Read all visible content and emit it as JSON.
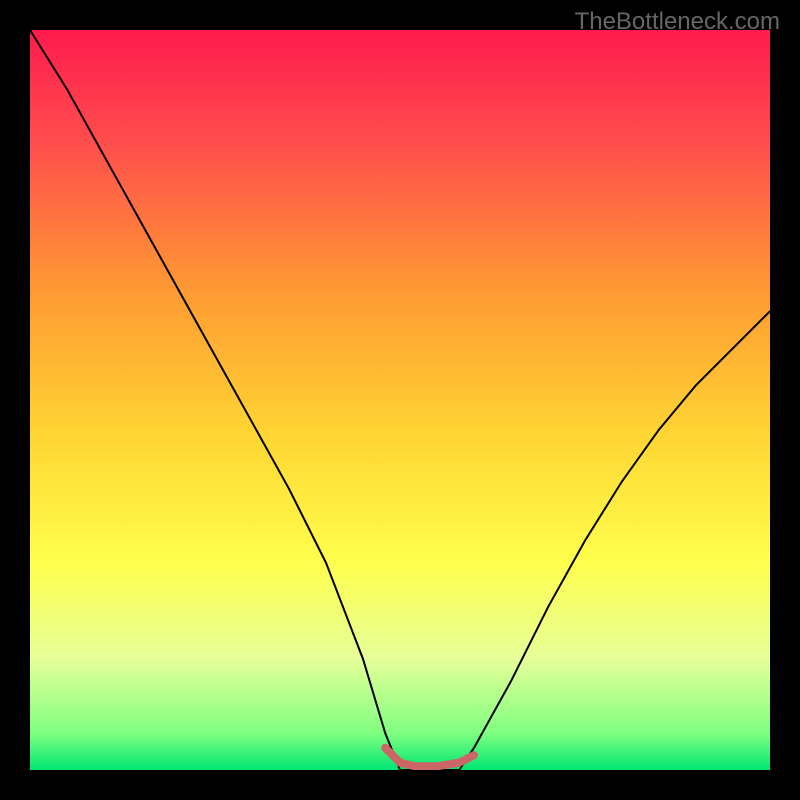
{
  "watermark": "TheBottleneck.com",
  "chart_data": {
    "type": "line",
    "title": "",
    "xlabel": "",
    "ylabel": "",
    "xlim": [
      0,
      100
    ],
    "ylim": [
      0,
      100
    ],
    "background_gradient": {
      "type": "vertical",
      "stops": [
        {
          "pos": 0.0,
          "color": "#ff1a4d"
        },
        {
          "pos": 0.15,
          "color": "#ff4d4d"
        },
        {
          "pos": 0.35,
          "color": "#ff9933"
        },
        {
          "pos": 0.55,
          "color": "#ffd633"
        },
        {
          "pos": 0.72,
          "color": "#ffff4d"
        },
        {
          "pos": 0.85,
          "color": "#e6ff99"
        },
        {
          "pos": 0.95,
          "color": "#80ff80"
        },
        {
          "pos": 1.0,
          "color": "#00e673"
        }
      ]
    },
    "series": [
      {
        "name": "bottleneck-curve",
        "color": "#000000",
        "stroke_width": 2,
        "x": [
          0,
          5,
          10,
          15,
          20,
          25,
          30,
          35,
          40,
          45,
          48,
          50,
          52,
          55,
          58,
          60,
          65,
          70,
          75,
          80,
          85,
          90,
          95,
          100
        ],
        "y": [
          100,
          92,
          83,
          74,
          65,
          56,
          47,
          38,
          28,
          15,
          5,
          0,
          0,
          0,
          0,
          3,
          12,
          22,
          31,
          39,
          46,
          52,
          57,
          62
        ]
      }
    ],
    "highlight_segment": {
      "name": "optimal-zone",
      "color": "#cc6666",
      "stroke_width": 8,
      "x": [
        48,
        50,
        52,
        55,
        58,
        60
      ],
      "y": [
        3,
        1,
        0.5,
        0.5,
        1,
        2
      ]
    }
  }
}
